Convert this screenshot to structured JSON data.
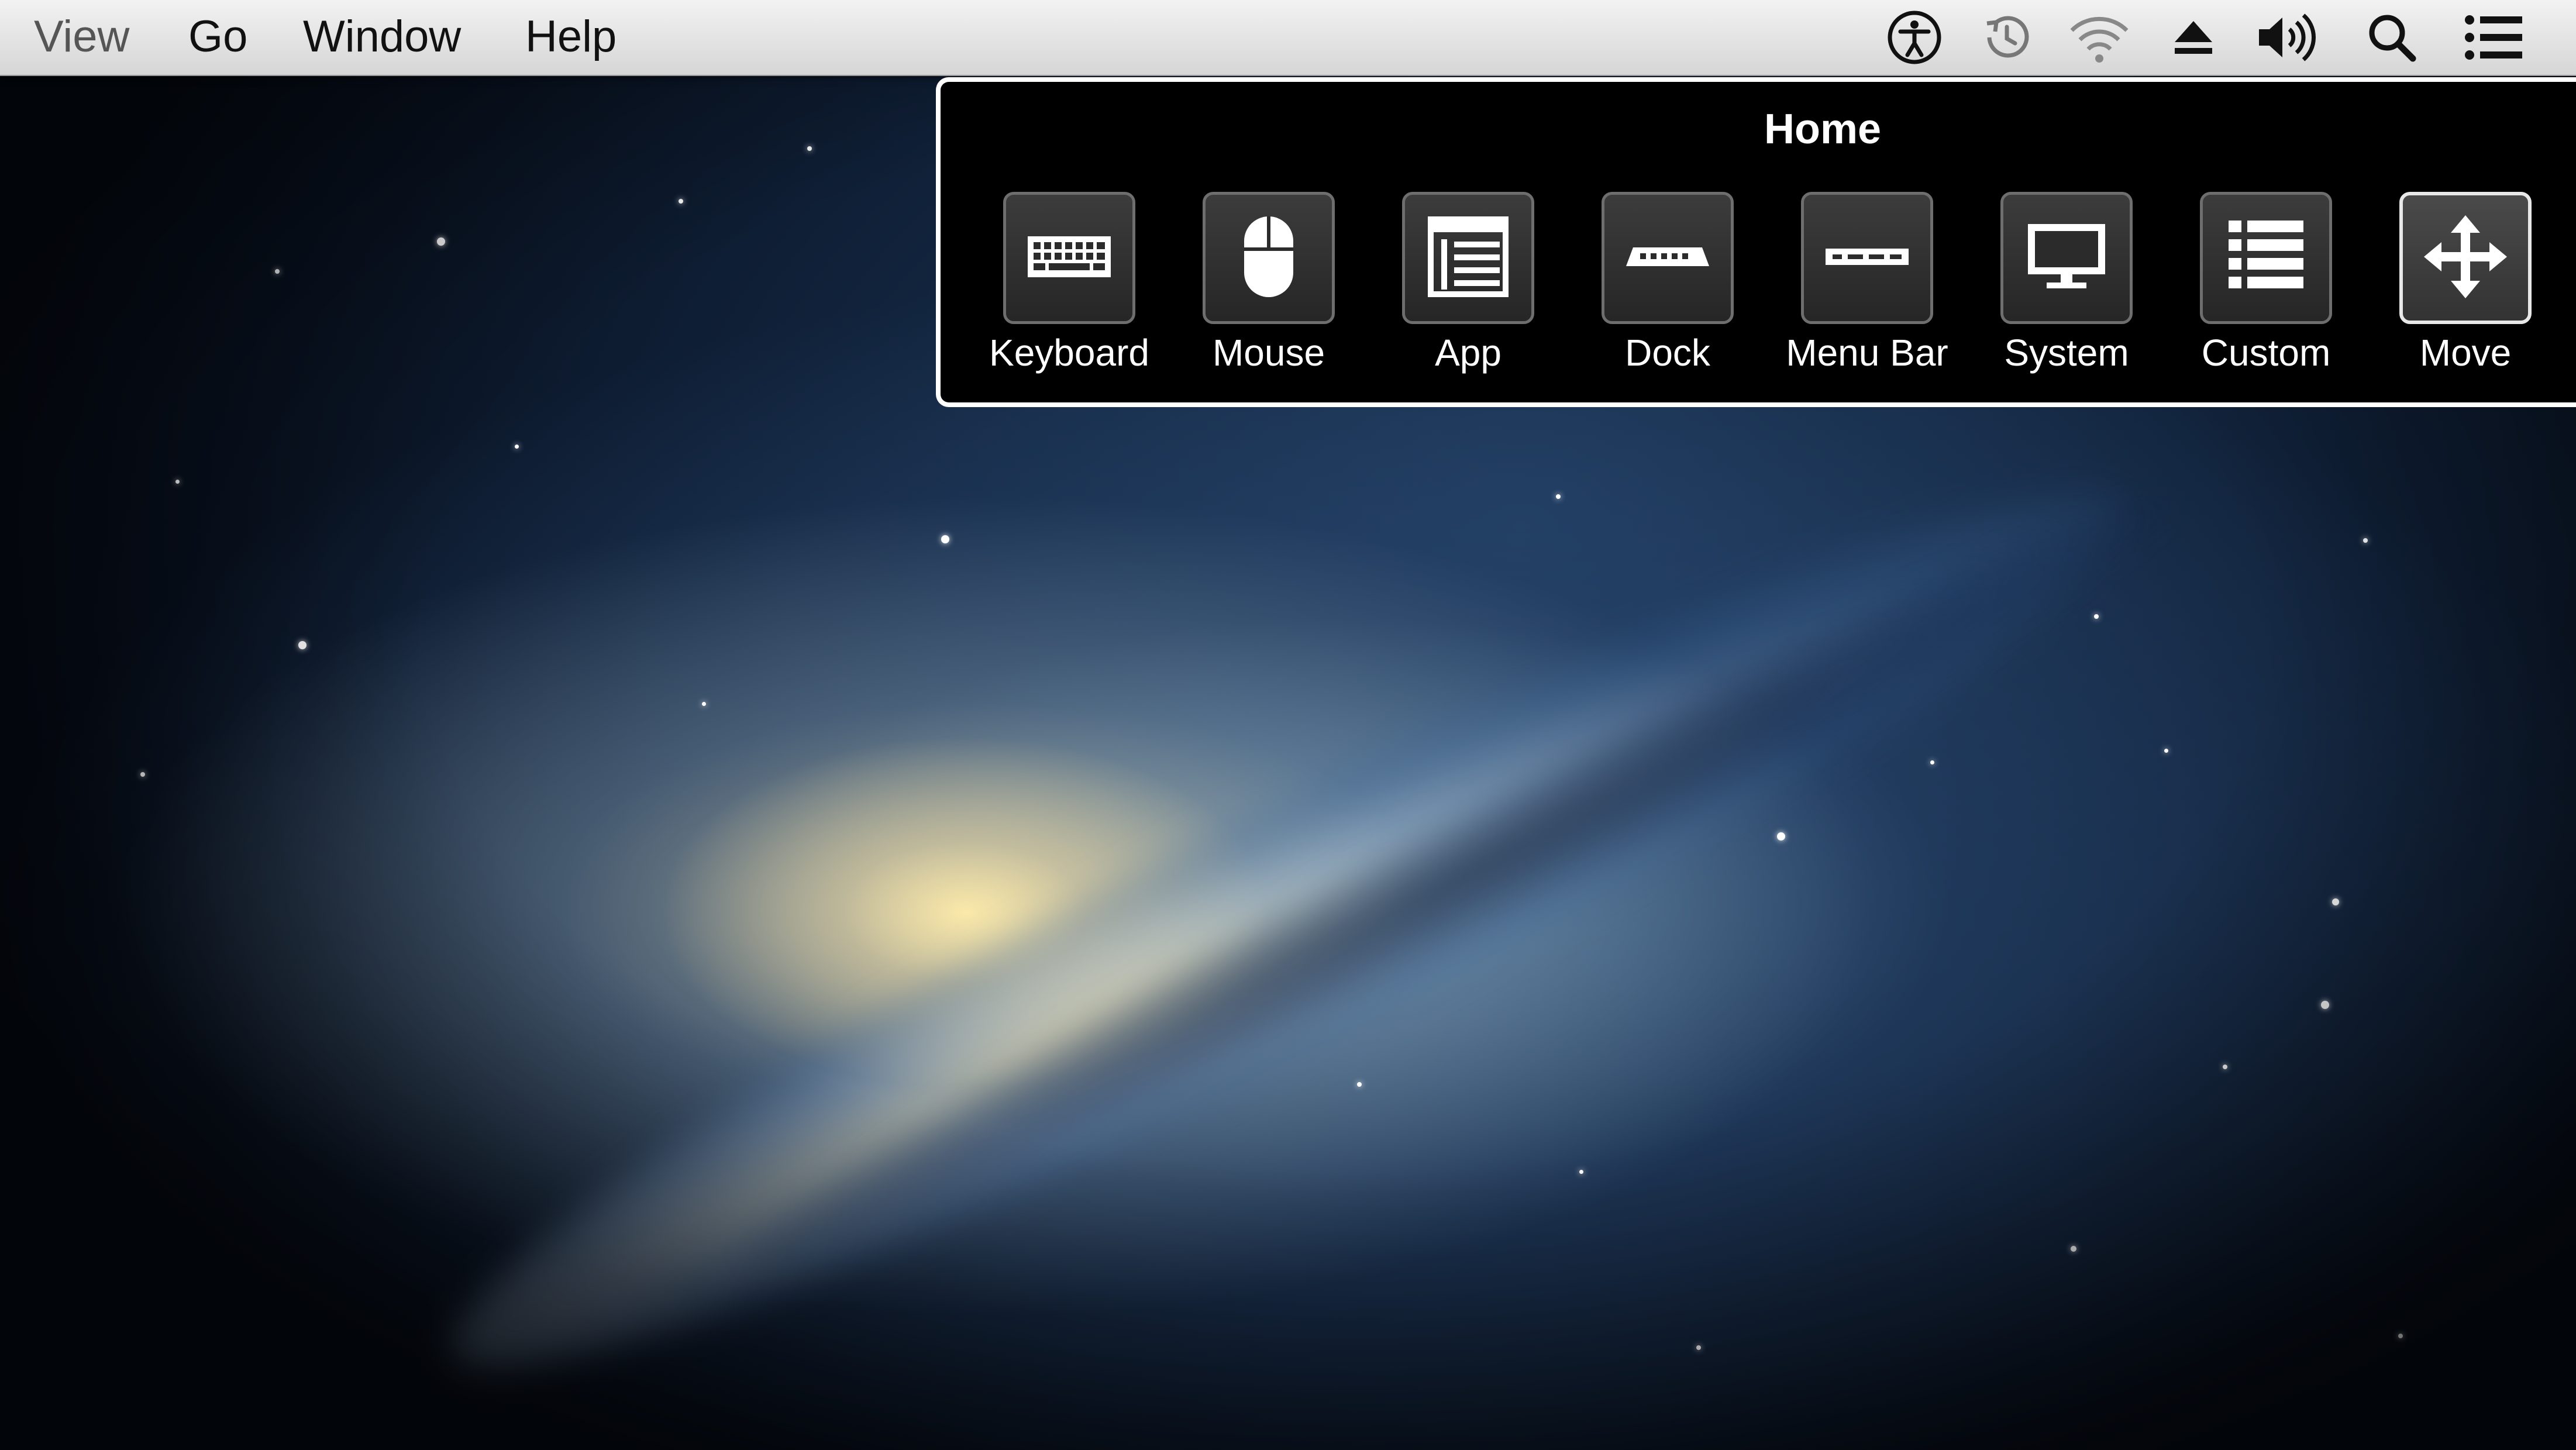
{
  "menu_bar": {
    "items": [
      {
        "label": "View"
      },
      {
        "label": "Go"
      },
      {
        "label": "Window"
      },
      {
        "label": "Help"
      }
    ],
    "status_icons": [
      "accessibility-icon",
      "time-machine-icon",
      "wifi-icon",
      "eject-icon",
      "volume-icon",
      "spotlight-search-icon",
      "notification-center-icon"
    ]
  },
  "panel": {
    "title": "Home",
    "tiles": [
      {
        "label": "Keyboard",
        "icon": "keyboard-icon",
        "selected": false
      },
      {
        "label": "Mouse",
        "icon": "mouse-icon",
        "selected": false
      },
      {
        "label": "App",
        "icon": "app-window-icon",
        "selected": false
      },
      {
        "label": "Dock",
        "icon": "dock-icon",
        "selected": false
      },
      {
        "label": "Menu Bar",
        "icon": "menu-bar-icon",
        "selected": false
      },
      {
        "label": "System",
        "icon": "monitor-icon",
        "selected": false
      },
      {
        "label": "Custom",
        "icon": "list-icon",
        "selected": false
      },
      {
        "label": "Move",
        "icon": "move-arrows-icon",
        "selected": true
      }
    ]
  },
  "colors": {
    "panel_background": "#000000",
    "panel_border": "#ffffff",
    "menu_bar_background": "#e6e6e6"
  }
}
